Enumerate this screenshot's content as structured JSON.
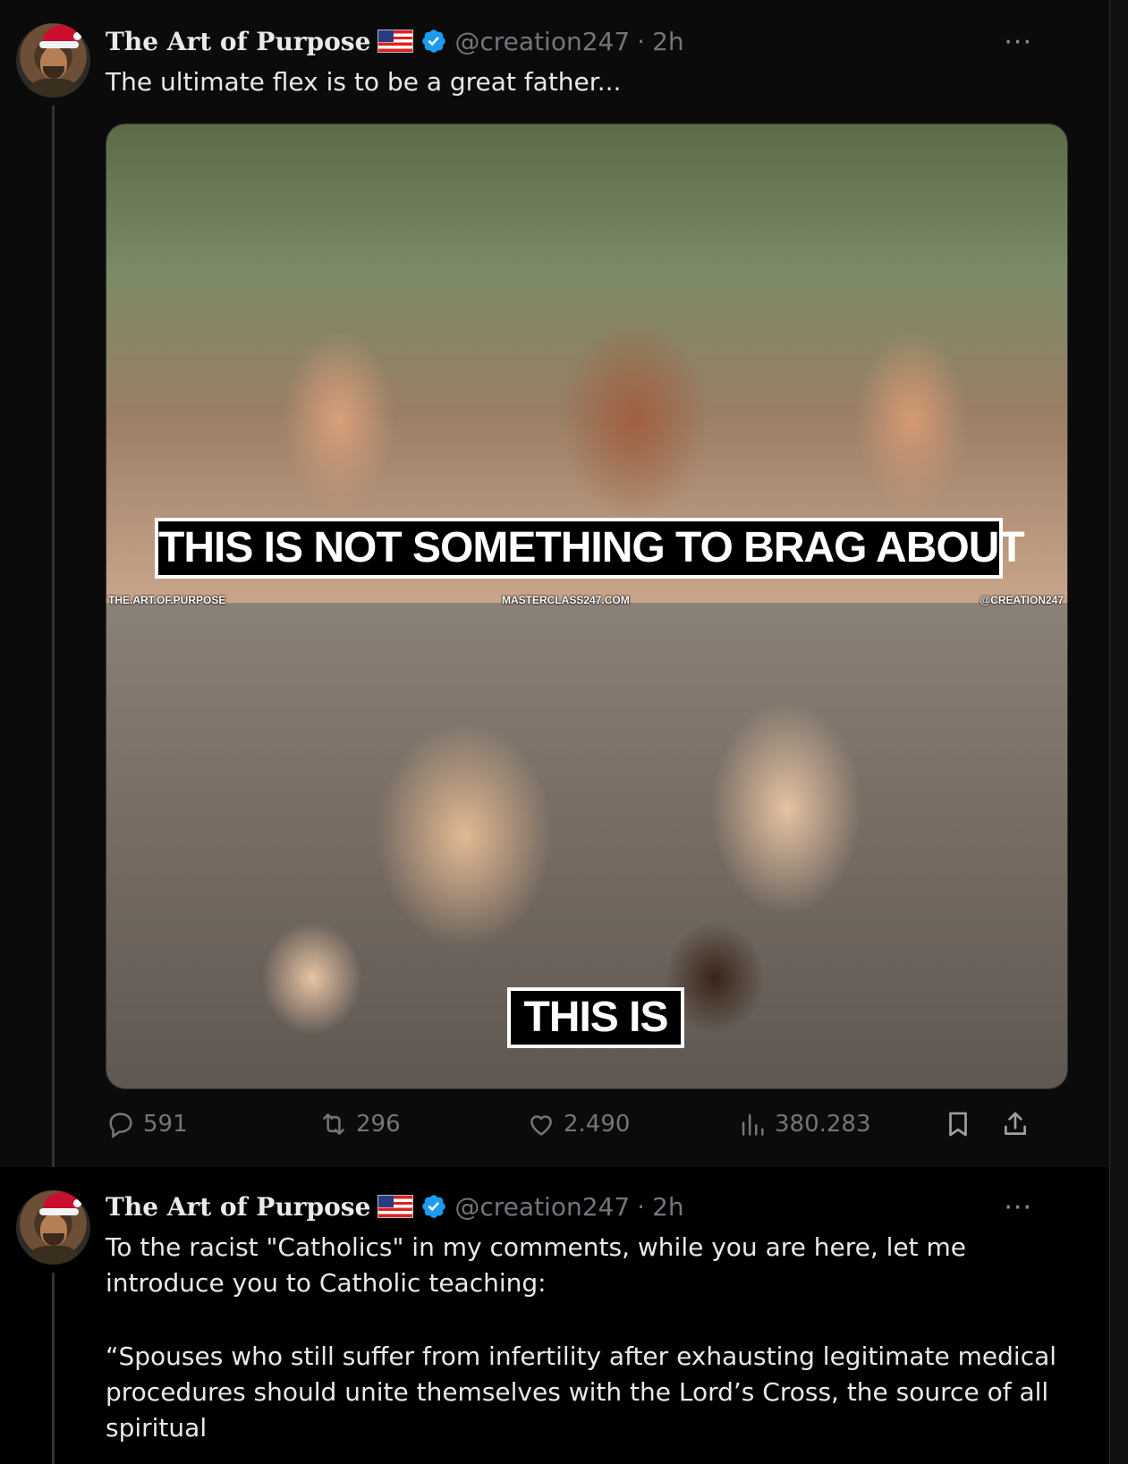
{
  "tweets": [
    {
      "author": "The Art of Purpose",
      "handle": "@creation247",
      "separator": "·",
      "time": "2h",
      "more": "···",
      "text": "The ultimate flex is to be a great father...",
      "media": {
        "caption_top": "THIS IS NOT SOMETHING TO BRAG ABOUT",
        "caption_bottom": "THIS IS",
        "watermark_left": "THE.ART.OF.PURPOSE",
        "watermark_center": "MASTERCLASS247.COM",
        "watermark_right": "@CREATION247"
      },
      "stats": {
        "replies": "591",
        "reposts": "296",
        "likes": "2.490",
        "views": "380.283"
      }
    },
    {
      "author": "The Art of Purpose",
      "handle": "@creation247",
      "separator": "·",
      "time": "2h",
      "more": "···",
      "text_line1": "To the racist \"Catholics\" in my comments, while you are here, let me",
      "text_line2": "introduce you to Catholic teaching:",
      "text_line3": "“Spouses who still suffer from infertility after exhausting legitimate medical",
      "text_line4": "procedures should unite themselves with the Lord’s Cross, the source of all",
      "text_line5": "spiritual"
    }
  ],
  "icons": {
    "flag": "us-flag-icon",
    "verified": "verified-badge-icon",
    "reply": "reply-icon",
    "repost": "repost-icon",
    "like": "heart-icon",
    "views": "views-icon",
    "bookmark": "bookmark-icon",
    "share": "share-icon"
  },
  "colors": {
    "background": "#000000",
    "text": "#e7e9ea",
    "muted": "#71767b",
    "verified": "#1d9bf0"
  }
}
